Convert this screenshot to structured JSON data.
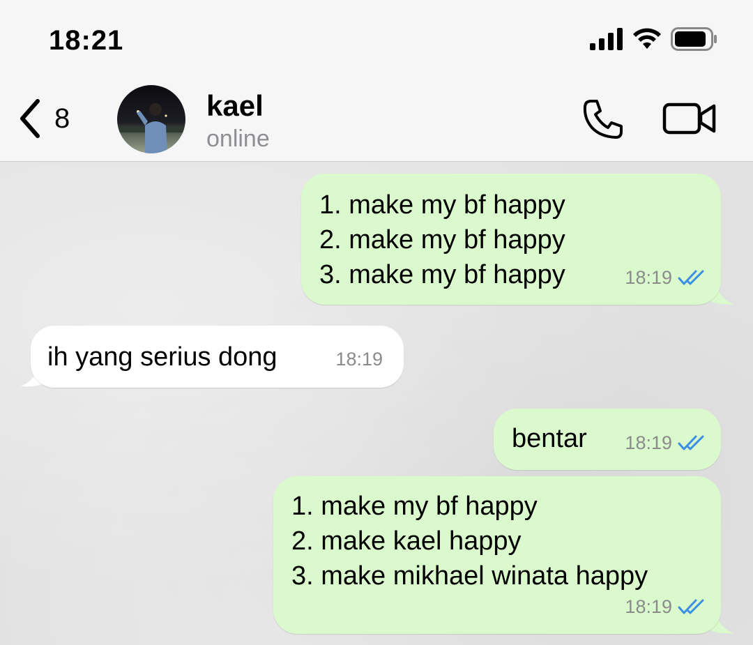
{
  "status_bar": {
    "time": "18:21",
    "icons": [
      "signal-icon",
      "wifi-icon",
      "battery-icon"
    ]
  },
  "header": {
    "back_count": "8",
    "contact_name": "kael",
    "contact_status": "online",
    "icons": [
      "chevron-left-icon",
      "phone-icon",
      "video-camera-icon"
    ]
  },
  "colors": {
    "outgoing_bubble": "#dafacd",
    "incoming_bubble": "#ffffff",
    "read_check": "#3a8ee6",
    "timestamp": "#8b8b8b"
  },
  "messages": [
    {
      "direction": "outgoing",
      "lines": [
        "1. make my bf happy",
        "2. make my bf happy",
        "3. make my bf happy"
      ],
      "time": "18:19",
      "read": true
    },
    {
      "direction": "incoming",
      "lines": [
        "ih yang serius dong"
      ],
      "time": "18:19"
    },
    {
      "direction": "outgoing",
      "lines": [
        "bentar"
      ],
      "time": "18:19",
      "read": true
    },
    {
      "direction": "outgoing",
      "lines": [
        "1. make my bf happy",
        "2. make kael happy",
        "3. make mikhael winata happy"
      ],
      "time": "18:19",
      "read": true
    }
  ]
}
